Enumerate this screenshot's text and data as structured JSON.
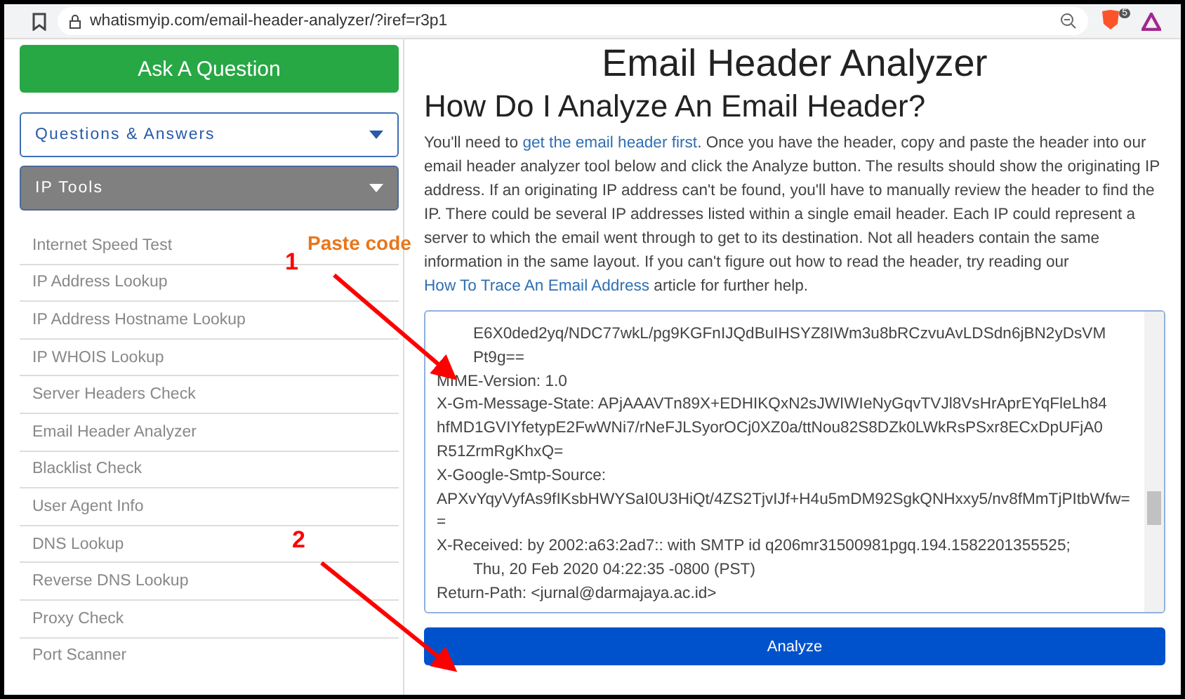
{
  "browser": {
    "url": "whatismyip.com/email-header-analyzer/?iref=r3p1",
    "badge": "5"
  },
  "sidebar": {
    "ask_button": "Ask A Question",
    "menus": [
      {
        "label": "Questions & Answers",
        "expanded": false
      },
      {
        "label": "IP Tools",
        "expanded": true
      }
    ],
    "items": [
      "Internet Speed Test",
      "IP Address Lookup",
      "IP Address Hostname Lookup",
      "IP WHOIS Lookup",
      "Server Headers Check",
      "Email Header Analyzer",
      "Blacklist Check",
      "User Agent Info",
      "DNS Lookup",
      "Reverse DNS Lookup",
      "Proxy Check",
      "Port Scanner"
    ]
  },
  "main": {
    "title": "Email Header Analyzer",
    "heading": "How Do I Analyze An Email Header?",
    "intro": [
      {
        "kind": "text",
        "text": "You'll need to "
      },
      {
        "kind": "link",
        "text": "get the email header first"
      },
      {
        "kind": "text",
        "text": ". Once you have the header, copy and paste the header into our email header analyzer tool below and click the Analyze button. The results should show the originating IP address. If an originating IP address can't be found, you'll have to manually review the header to find the IP. There could be several IP addresses listed within a single email header. Each IP could represent a server to which the email went through to get to its destination. Not all headers contain the same information in the same layout. If you can't figure out how to read the header, try reading our "
      },
      {
        "kind": "link",
        "text": "How To Trace An Email Address"
      },
      {
        "kind": "text",
        "text": " article for further help."
      }
    ],
    "header_lines": [
      {
        "text": "E6X0ded2yq/NDC77wkL/pg9KGFnIJQdBuIHSYZ8IWm3u8bRCzvuAvLDSdn6jBN2yDsVM",
        "indent": true
      },
      {
        "text": "Pt9g==",
        "indent": true
      },
      {
        "text": "MIME-Version: 1.0",
        "indent": false
      },
      {
        "text": "X-Gm-Message-State: APjAAAVTn89X+EDHIKQxN2sJWIWIeNyGqvTVJl8VsHrAprEYqFleLh84",
        "indent": false
      },
      {
        "text": "hfMD1GVIYfetypE2FwWNi7/rNeFJLSyorOCj0XZ0a/ttNou82S8DZk0LWkRsPSxr8ECxDpUFjA0",
        "indent": false
      },
      {
        "text": "R51ZrmRgKhxQ=",
        "indent": false
      },
      {
        "text": "X-Google-Smtp-Source:",
        "indent": false
      },
      {
        "text": "APXvYqyVyfAs9fIKsbHWYSaI0U3HiQt/4ZS2TjvIJf+H4u5mDM92SgkQNHxxy5/nv8fMmTjPItbWfw=",
        "indent": false
      },
      {
        "text": "=",
        "indent": false
      },
      {
        "text": "X-Received: by 2002:a63:2ad7:: with SMTP id q206mr31500981pgq.194.1582201355525;",
        "indent": false
      },
      {
        "text": "Thu, 20 Feb 2020 04:22:35 -0800 (PST)",
        "indent": true
      },
      {
        "text": "Return-Path: <jurnal@darmajaya.ac.id>",
        "indent": false
      }
    ],
    "analyze_button": "Analyze"
  },
  "annotations": [
    {
      "number": "1",
      "caption": "Paste code"
    },
    {
      "number": "2"
    }
  ]
}
